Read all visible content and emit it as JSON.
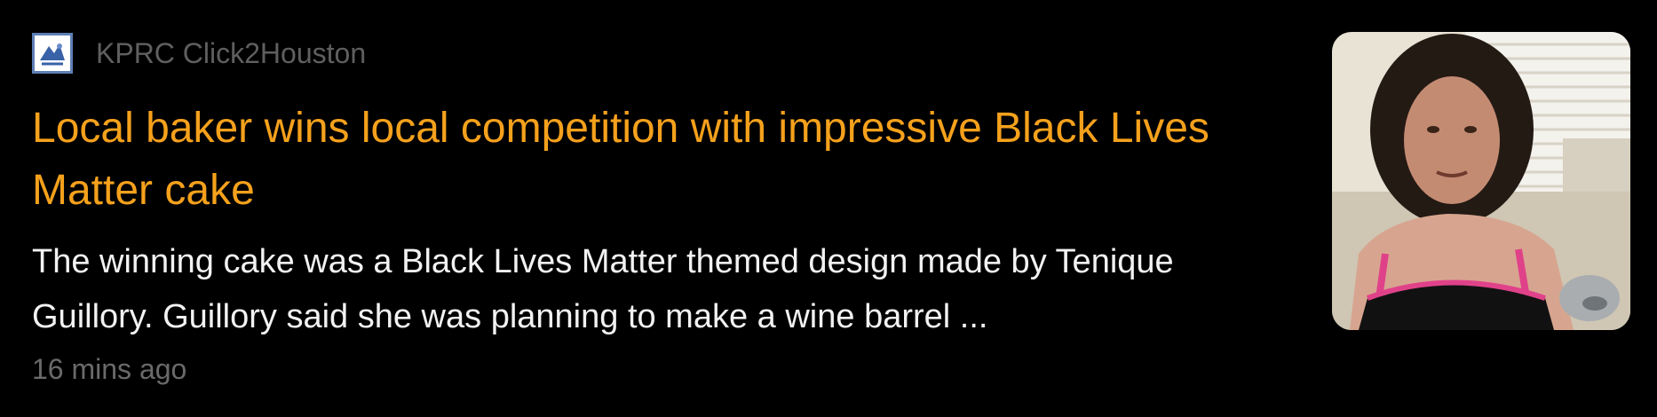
{
  "article": {
    "source": {
      "name": "KPRC Click2Houston",
      "logo_icon": "kprc-logo-icon"
    },
    "headline": "Local baker wins local competition with impressive Black Lives Matter cake",
    "snippet": "The winning cake was a Black Lives Matter themed design made by Tenique Guillory. Guillory said she was planning to make a wine barrel ...",
    "time_ago": "16 mins ago",
    "thumbnail": {
      "icon": "news-photo-thumbnail"
    }
  },
  "colors": {
    "background": "#000000",
    "headline": "#f5a11c",
    "snippet": "#f2f2f2",
    "meta": "#6a6a6a",
    "source": "#5f5f5f"
  }
}
